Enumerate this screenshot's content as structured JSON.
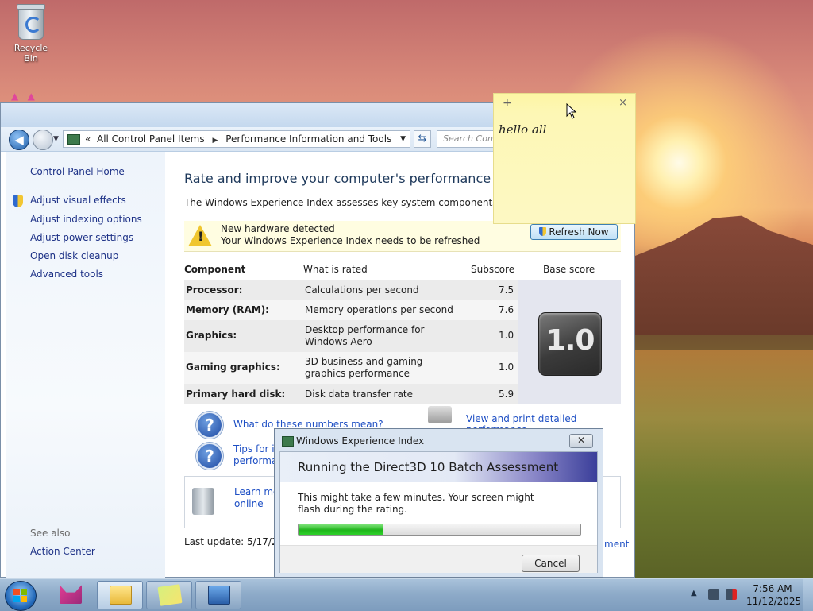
{
  "desktop": {
    "recycle_bin_label": "Recycle Bin"
  },
  "window": {
    "breadcrumb": {
      "root": "All Control Panel Items",
      "current": "Performance Information and Tools"
    },
    "search_placeholder": "Search Cont",
    "left_pane": {
      "home": "Control Panel Home",
      "links": [
        "Adjust visual effects",
        "Adjust indexing options",
        "Adjust power settings",
        "Open disk cleanup",
        "Advanced tools"
      ],
      "see_also_header": "See also",
      "see_also_link": "Action Center"
    },
    "main": {
      "title": "Rate and improve your computer's performance",
      "intro": "The Windows Experience Index assesses key system components on a scale",
      "notice": {
        "line1": "New hardware detected",
        "line2": "Your Windows Experience Index needs to be refreshed",
        "button": "Refresh Now"
      },
      "table": {
        "headers": [
          "Component",
          "What is rated",
          "Subscore",
          "Base score"
        ],
        "rows": [
          {
            "component": "Processor:",
            "rated": "Calculations per second",
            "subscore": "7.5"
          },
          {
            "component": "Memory (RAM):",
            "rated": "Memory operations per second",
            "subscore": "7.6"
          },
          {
            "component": "Graphics:",
            "rated": "Desktop performance for Windows Aero",
            "subscore": "1.0"
          },
          {
            "component": "Gaming graphics:",
            "rated": "3D business and gaming graphics performance",
            "subscore": "1.0"
          },
          {
            "component": "Primary hard disk:",
            "rated": "Disk data transfer rate",
            "subscore": "5.9"
          }
        ],
        "base_score": "1.0"
      },
      "links": {
        "numbers": "What do these numbers mean?",
        "tips_line1": "Tips for in",
        "tips_line2": "performan",
        "print_details": "View and print detailed performance",
        "learn_line1": "Learn mo",
        "learn_line2": "online",
        "ment": "ment"
      },
      "last_update": "Last update: 5/17/202"
    }
  },
  "sticky_note": {
    "text": "hello all",
    "add": "+",
    "close": "×"
  },
  "dialog": {
    "title": "Windows Experience Index",
    "close": "✕",
    "heading": "Running the Direct3D 10 Batch Assessment",
    "message": "This might take a few minutes. Your screen might flash during the rating.",
    "progress_percent": 30,
    "cancel": "Cancel"
  },
  "taskbar": {
    "time": "7:56 AM",
    "date": "11/12/2025"
  }
}
